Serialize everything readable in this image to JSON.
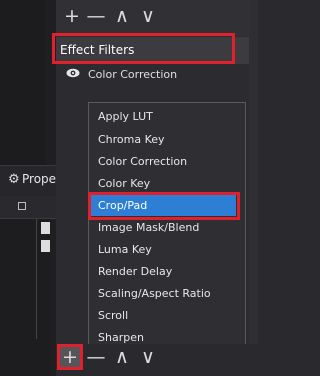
{
  "left_panel": {
    "properties_label": "Prope",
    "gear_icon": "gear-icon"
  },
  "top_toolbar": {
    "add": "+",
    "remove": "—",
    "up": "∧",
    "down": "∨"
  },
  "effect_filters": {
    "title": "Effect Filters",
    "items": [
      {
        "label": "Color Correction",
        "icon": "eye-icon"
      }
    ]
  },
  "add_menu": {
    "items": [
      "Apply LUT",
      "Chroma Key",
      "Color Correction",
      "Color Key",
      "Crop/Pad",
      "Image Mask/Blend",
      "Luma Key",
      "Render Delay",
      "Scaling/Aspect Ratio",
      "Scroll",
      "Sharpen"
    ],
    "selected": "Crop/Pad"
  },
  "bottom_toolbar": {
    "add": "+",
    "remove": "—",
    "up": "∧",
    "down": "∨"
  },
  "colors": {
    "highlight": "#e0202d",
    "selection": "#2d7fd6"
  }
}
